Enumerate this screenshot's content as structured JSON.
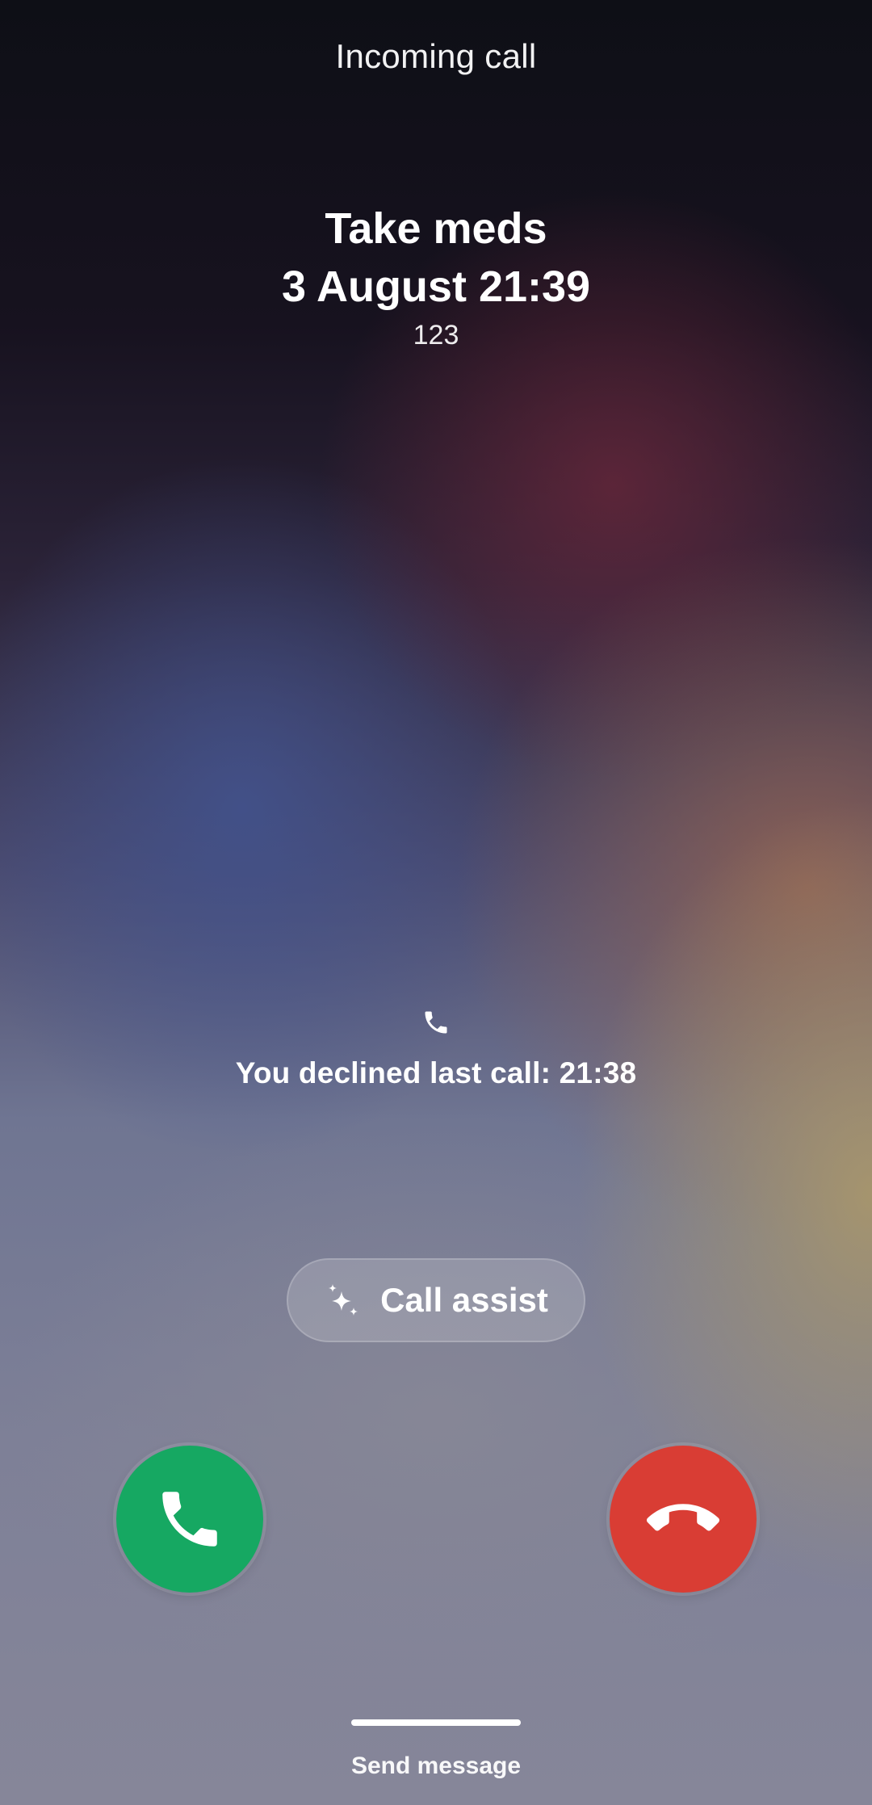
{
  "header": {
    "title": "Incoming call"
  },
  "caller": {
    "name": "Take meds",
    "date_time": "3 August 21:39",
    "number": "123"
  },
  "last_call": {
    "icon": "phone-icon",
    "text": "You declined last call: 21:38"
  },
  "assist": {
    "icon": "sparkle-icon",
    "label": "Call assist"
  },
  "actions": {
    "answer_icon": "phone-answer-icon",
    "answer_color": "#16a862",
    "decline_icon": "phone-hangup-icon",
    "decline_color": "#d93d34"
  },
  "footer": {
    "send_message_label": "Send message"
  }
}
